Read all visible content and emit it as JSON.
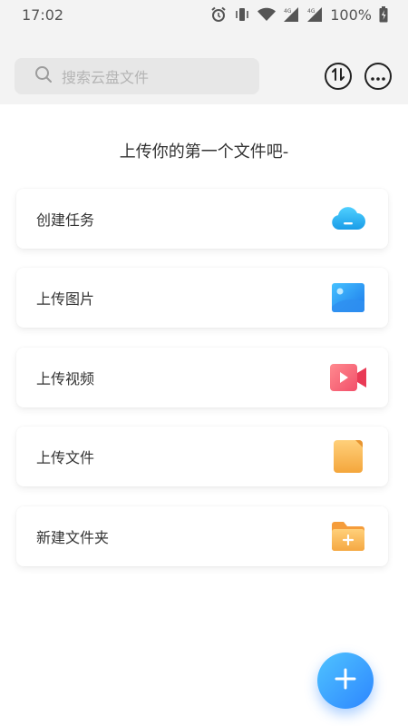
{
  "status_bar": {
    "time": "17:02",
    "battery_text": "100%",
    "network_label": "4G"
  },
  "search": {
    "placeholder": "搜索云盘文件"
  },
  "main": {
    "hint": "上传你的第一个文件吧-",
    "cards": [
      {
        "label": "创建任务",
        "icon": "cloud-icon",
        "color": "#26b3f5"
      },
      {
        "label": "上传图片",
        "icon": "image-icon",
        "color": "#2a8cf0"
      },
      {
        "label": "上传视频",
        "icon": "video-icon",
        "color": "#f5556c"
      },
      {
        "label": "上传文件",
        "icon": "file-icon",
        "color": "#f7b95a"
      },
      {
        "label": "新建文件夹",
        "icon": "folder-add-icon",
        "color": "#f7a948"
      }
    ]
  },
  "colors": {
    "accent": "#2d86ff",
    "header_bg": "#f3f3f3"
  }
}
